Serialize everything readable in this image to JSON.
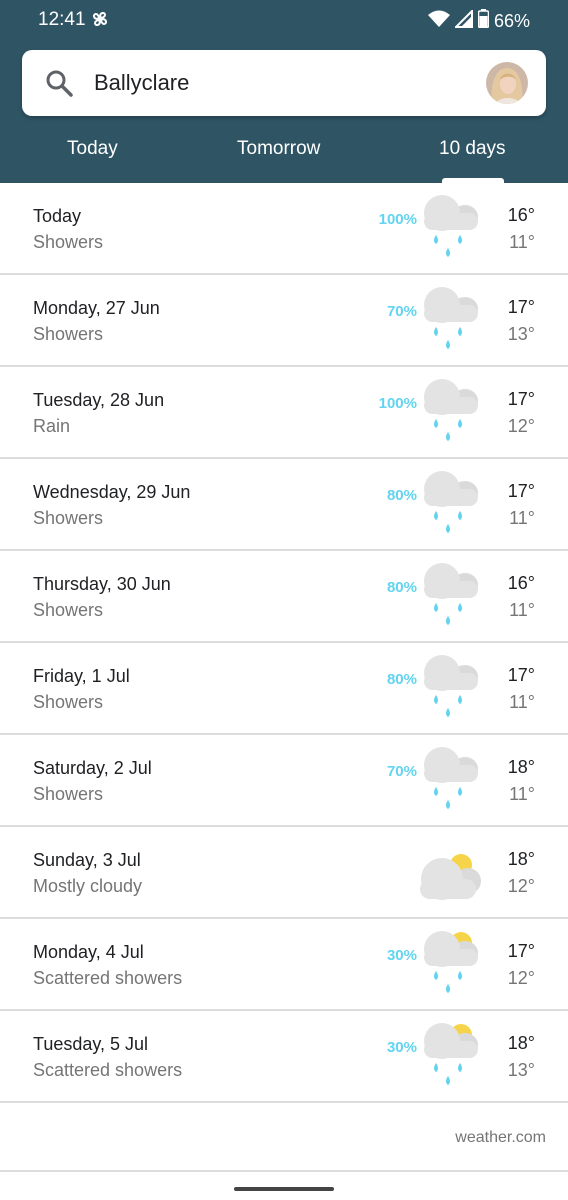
{
  "status_bar": {
    "time": "12:41",
    "battery": "66%",
    "icons": [
      "pinwheel-icon",
      "wifi-icon",
      "signal-icon",
      "battery-icon"
    ]
  },
  "search": {
    "query": "Ballyclare"
  },
  "tabs": [
    {
      "label": "Today",
      "selected": false
    },
    {
      "label": "Tomorrow",
      "selected": false
    },
    {
      "label": "10 days",
      "selected": true
    }
  ],
  "days": [
    {
      "day": "Today",
      "condition": "Showers",
      "precip": "100%",
      "icon": "showers",
      "high": "16°",
      "low": "11°"
    },
    {
      "day": "Monday, 27 Jun",
      "condition": "Showers",
      "precip": "70%",
      "icon": "showers",
      "high": "17°",
      "low": "13°"
    },
    {
      "day": "Tuesday, 28 Jun",
      "condition": "Rain",
      "precip": "100%",
      "icon": "showers",
      "high": "17°",
      "low": "12°"
    },
    {
      "day": "Wednesday, 29 Jun",
      "condition": "Showers",
      "precip": "80%",
      "icon": "showers",
      "high": "17°",
      "low": "11°"
    },
    {
      "day": "Thursday, 30 Jun",
      "condition": "Showers",
      "precip": "80%",
      "icon": "showers",
      "high": "16°",
      "low": "11°"
    },
    {
      "day": "Friday, 1 Jul",
      "condition": "Showers",
      "precip": "80%",
      "icon": "showers",
      "high": "17°",
      "low": "11°"
    },
    {
      "day": "Saturday, 2 Jul",
      "condition": "Showers",
      "precip": "70%",
      "icon": "showers",
      "high": "18°",
      "low": "11°"
    },
    {
      "day": "Sunday, 3 Jul",
      "condition": "Mostly cloudy",
      "precip": "",
      "icon": "mostly-cloudy",
      "high": "18°",
      "low": "12°"
    },
    {
      "day": "Monday, 4 Jul",
      "condition": "Scattered showers",
      "precip": "30%",
      "icon": "scattered-showers",
      "high": "17°",
      "low": "12°"
    },
    {
      "day": "Tuesday, 5 Jul",
      "condition": "Scattered showers",
      "precip": "30%",
      "icon": "scattered-showers",
      "high": "18°",
      "low": "13°"
    }
  ],
  "footer": {
    "credit": "weather.com"
  },
  "colors": {
    "header_bg": "#2f5565",
    "precip_text": "#62d4f0",
    "rain_drop": "#62d4f0",
    "sun": "#f6d44a",
    "cloud": "#e3e3e3"
  }
}
